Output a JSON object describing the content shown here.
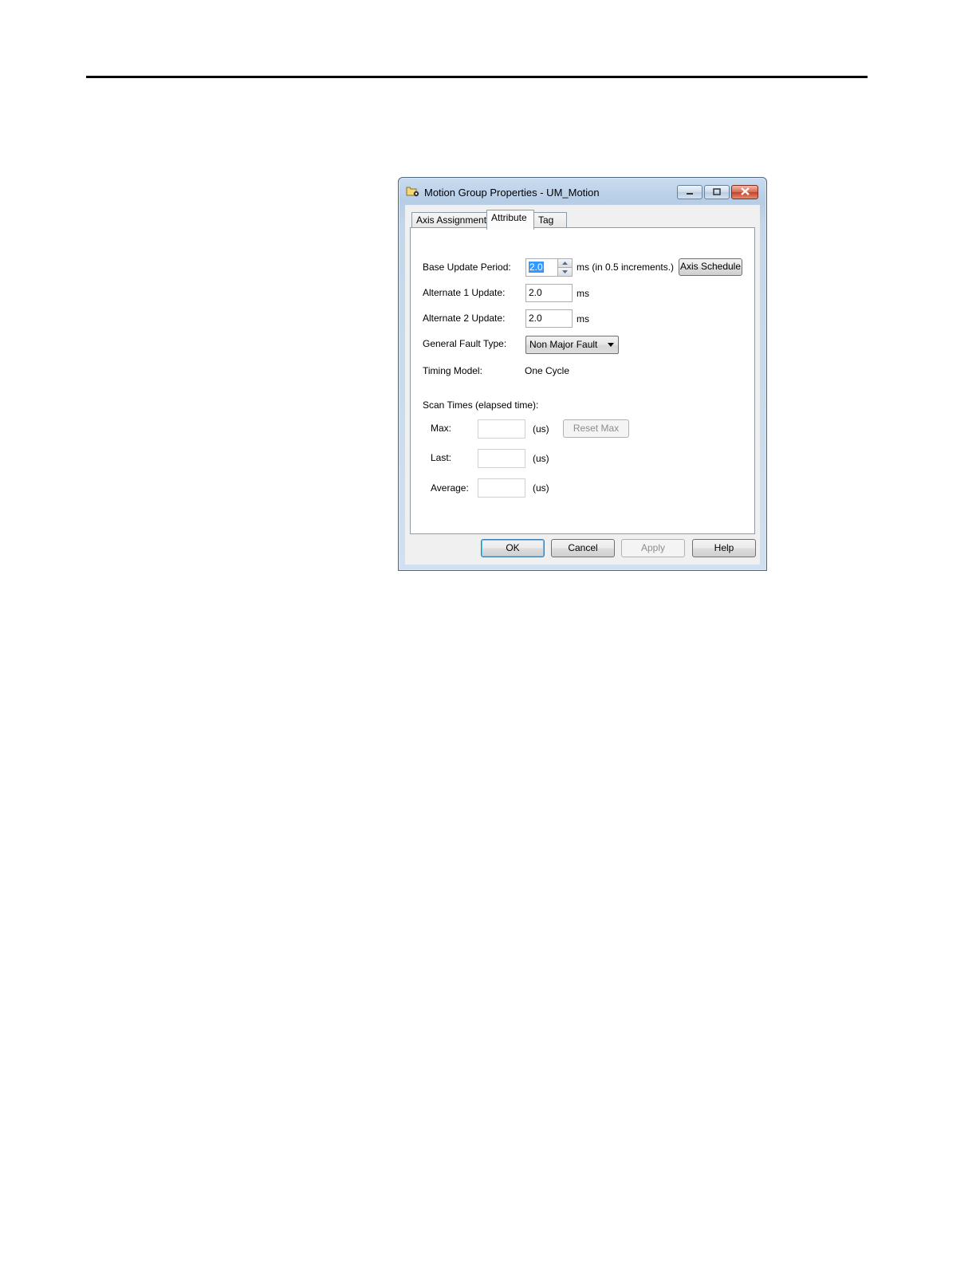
{
  "window": {
    "title": "Motion Group Properties - UM_Motion",
    "caption_buttons": [
      "minimize-icon",
      "maximize-icon",
      "close-icon"
    ]
  },
  "tabs": [
    {
      "label": "Axis Assignment",
      "active": false
    },
    {
      "label": "Attribute",
      "active": true
    },
    {
      "label": "Tag",
      "active": false
    }
  ],
  "attribute": {
    "base_update_period": {
      "label": "Base Update Period:",
      "value": "2.0",
      "units": "ms (in 0.5 increments.)"
    },
    "axis_schedule_button": "Axis Schedule",
    "alternate1": {
      "label": "Alternate 1 Update:",
      "value": "2.0",
      "units": "ms"
    },
    "alternate2": {
      "label": "Alternate 2 Update:",
      "value": "2.0",
      "units": "ms"
    },
    "fault_type": {
      "label": "General Fault Type:",
      "value": "Non Major Fault"
    },
    "timing_model": {
      "label": "Timing Model:",
      "value": "One Cycle"
    },
    "scan_times": {
      "heading": "Scan Times (elapsed time):",
      "max": {
        "label": "Max:",
        "value": "",
        "units": "(us)"
      },
      "last": {
        "label": "Last:",
        "value": "",
        "units": "(us)"
      },
      "average": {
        "label": "Average:",
        "value": "",
        "units": "(us)"
      },
      "reset_button": "Reset Max"
    }
  },
  "footer": {
    "ok": "OK",
    "cancel": "Cancel",
    "apply": "Apply",
    "help": "Help"
  },
  "colors": {
    "selection": "#3399ff",
    "close_button": "#c6412a",
    "frame": "#c3d7ec"
  }
}
